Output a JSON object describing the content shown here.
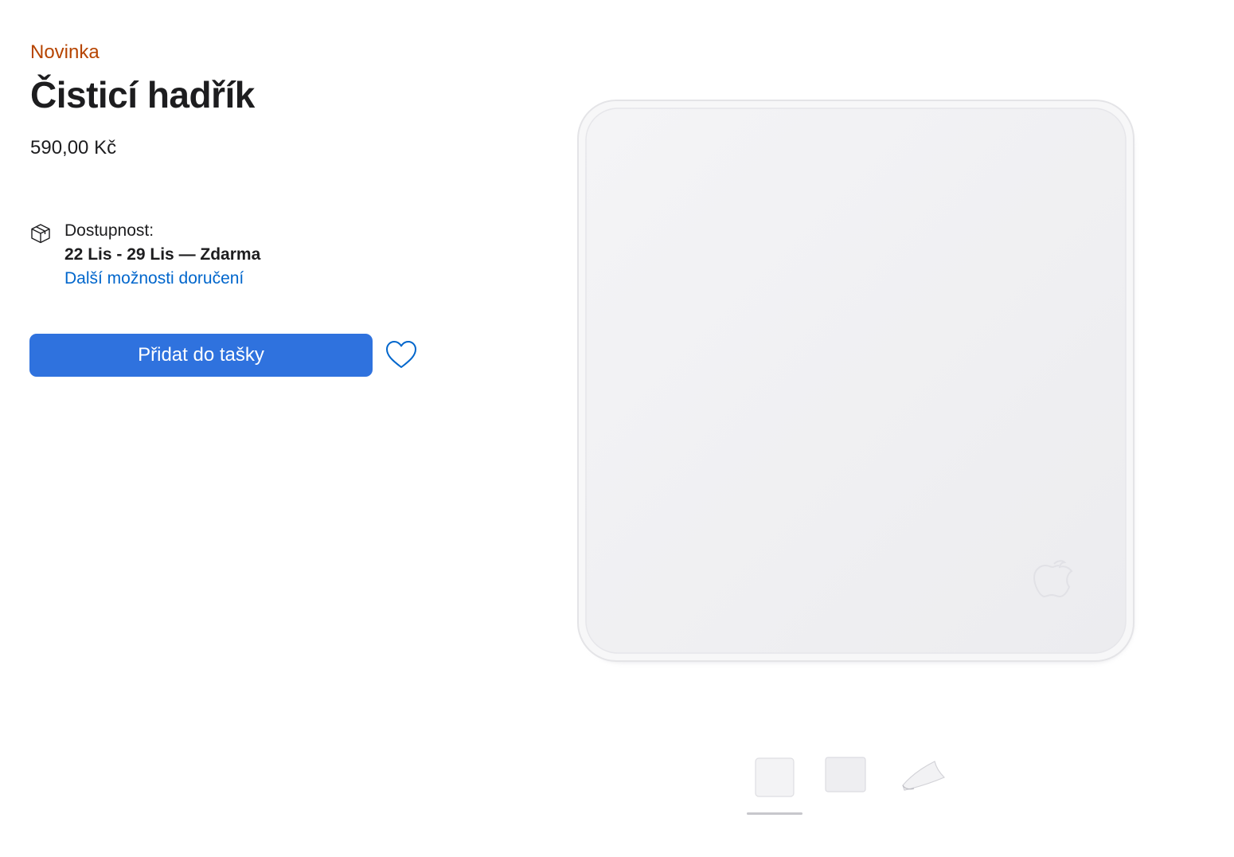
{
  "product": {
    "badge": "Novinka",
    "title": "Čisticí hadřík",
    "price": "590,00 Kč"
  },
  "availability": {
    "icon": "box-icon",
    "label": "Dostupnost:",
    "dates": "22 Lis - 29 Lis — Zdarma",
    "more_link": "Další možnosti doručení"
  },
  "actions": {
    "add_to_bag": "Přidat do tašky",
    "favorite_icon": "heart-icon"
  },
  "gallery": {
    "selected_index": 0,
    "thumbnails": [
      "cloth-front-thumbnail",
      "cloth-back-thumbnail",
      "cloth-folded-thumbnail"
    ]
  },
  "colors": {
    "badge": "#b64400",
    "button": "#2f72de",
    "link": "#0066cc",
    "text": "#1d1d1f"
  }
}
